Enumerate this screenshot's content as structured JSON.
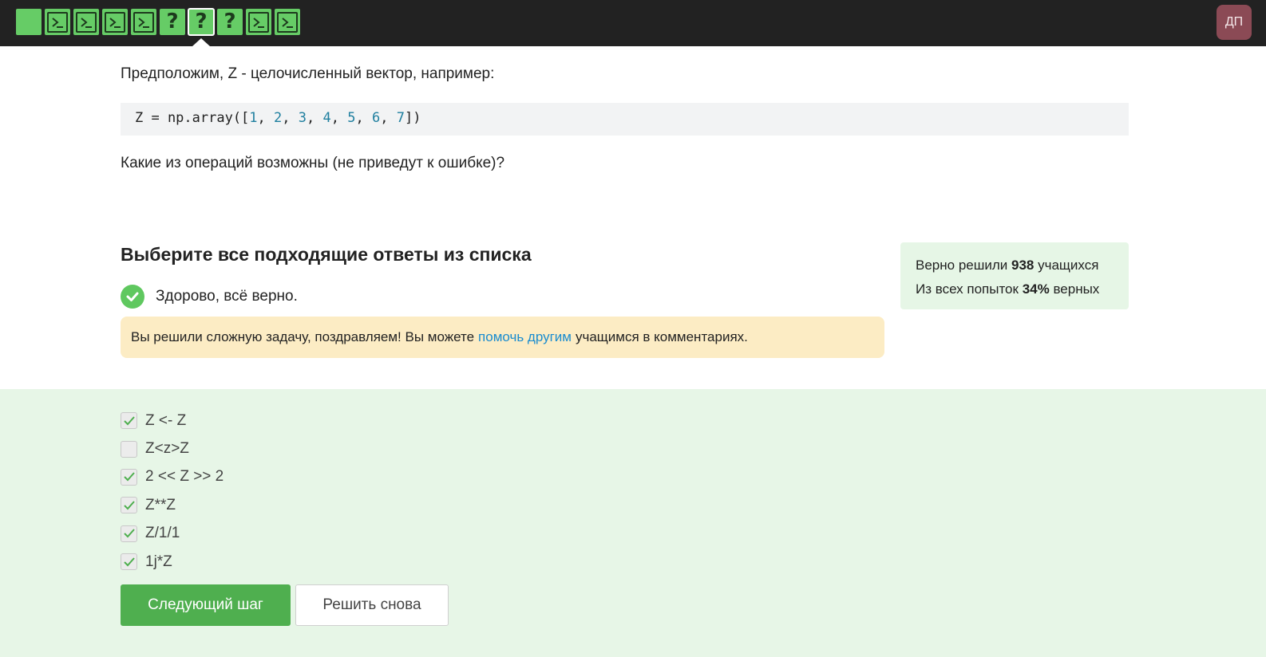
{
  "topbar": {
    "steps": [
      {
        "type": "blank",
        "icon": "blank-step-icon"
      },
      {
        "type": "code",
        "icon": "terminal-icon"
      },
      {
        "type": "code",
        "icon": "terminal-icon"
      },
      {
        "type": "code",
        "icon": "terminal-icon"
      },
      {
        "type": "code",
        "icon": "terminal-icon"
      },
      {
        "type": "question",
        "label": "?",
        "icon": "question-icon"
      },
      {
        "type": "question",
        "label": "?",
        "icon": "question-icon",
        "active": true
      },
      {
        "type": "question",
        "label": "?",
        "icon": "question-icon"
      },
      {
        "type": "code",
        "icon": "terminal-icon"
      },
      {
        "type": "code",
        "icon": "terminal-icon"
      }
    ],
    "avatar_initials": "ДП",
    "step_color": "#66cc66",
    "bar_color": "#222222"
  },
  "task": {
    "intro": "Предположим, Z - целочисленный вектор, например:",
    "code_prefix": "Z = np.array([",
    "code_numbers": [
      "1",
      "2",
      "3",
      "4",
      "5",
      "6",
      "7"
    ],
    "code_suffix": "])",
    "question": "Какие из операций возможны (не приведут к ошибке)?"
  },
  "result": {
    "heading": "Выберите все подходящие ответы из списка",
    "correct_text": "Здорово, всё верно.",
    "congrats_before": "Вы решили сложную задачу, поздравляем! Вы можете",
    "congrats_link": "помочь другим",
    "congrats_after": "учащимся в комментариях."
  },
  "stats": {
    "line1_before": "Верно решили",
    "line1_value": "938",
    "line1_after": "учащихся",
    "line2_before": "Из всех попыток",
    "line2_value": "34%",
    "line2_after": "верных"
  },
  "options": [
    {
      "label": "Z <- Z",
      "checked": true
    },
    {
      "label": "Z<z>Z",
      "checked": false
    },
    {
      "label": "2 << Z >> 2",
      "checked": true
    },
    {
      "label": "Z**Z",
      "checked": true
    },
    {
      "label": "Z/1/1",
      "checked": true
    },
    {
      "label": "1j*Z",
      "checked": true
    }
  ],
  "buttons": {
    "next": "Следующий шаг",
    "again": "Решить снова"
  },
  "colors": {
    "accent_green": "#4faf4f",
    "success_green": "#5fc85f",
    "link_blue": "#1a8ccf",
    "notice_bg": "#fcecc4",
    "answers_bg": "#e7f6e7"
  }
}
